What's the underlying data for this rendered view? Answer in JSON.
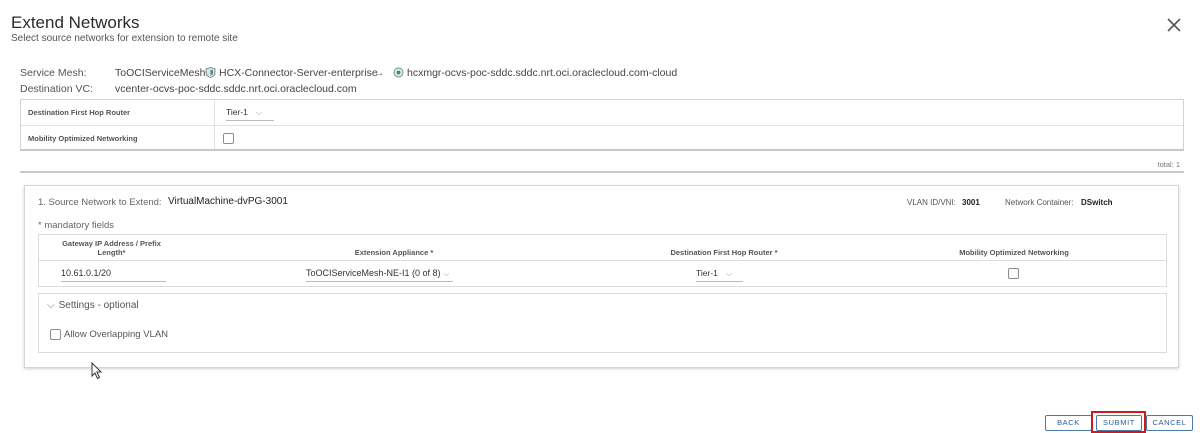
{
  "dialog": {
    "title": "Extend Networks",
    "subtitle": "Select source networks for extension to remote site"
  },
  "info": {
    "service_mesh_label": "Service Mesh:",
    "service_mesh_name": "ToOCIServiceMesh :",
    "connector": "HCX-Connector-Server-enterprise",
    "arrow": "→",
    "remote": "hcxmgr-ocvs-poc-sddc.sddc.nrt.oci.oraclecloud.com-cloud",
    "destination_vc_label": "Destination VC:",
    "destination_vc": "vcenter-ocvs-poc-sddc.sddc.nrt.oci.oraclecloud.com"
  },
  "options": {
    "first_hop_label": "Destination First Hop Router",
    "first_hop_value": "Tier-1",
    "mon_label": "Mobility Optimized Networking"
  },
  "total_text": "total: 1",
  "network": {
    "source_label": "1. Source Network to Extend:",
    "source_value": "VirtualMachine-dvPG-3001",
    "vlan_label": "VLAN ID/VNI:",
    "vlan_value": "3001",
    "container_label": "Network Container:",
    "container_value": "DSwitch",
    "mandatory": "* mandatory fields",
    "columns": {
      "gateway": "Gateway IP Address / Prefix Length*",
      "appliance": "Extension Appliance *",
      "first_hop": "Destination First Hop Router *",
      "mon": "Mobility Optimized Networking"
    },
    "row": {
      "gateway": "10.61.0.1/20",
      "appliance": "ToOCIServiceMesh-NE-I1 (0 of 8)",
      "first_hop": "Tier-1"
    },
    "settings_label": "Settings - optional",
    "overlap_label": "Allow Overlapping VLAN"
  },
  "buttons": {
    "back": "BACK",
    "submit": "SUBMIT",
    "cancel": "CANCEL"
  },
  "colors": {
    "button_border": "#4a7aa7",
    "highlight": "#d0181f",
    "accent_green": "#4a8f6e"
  }
}
